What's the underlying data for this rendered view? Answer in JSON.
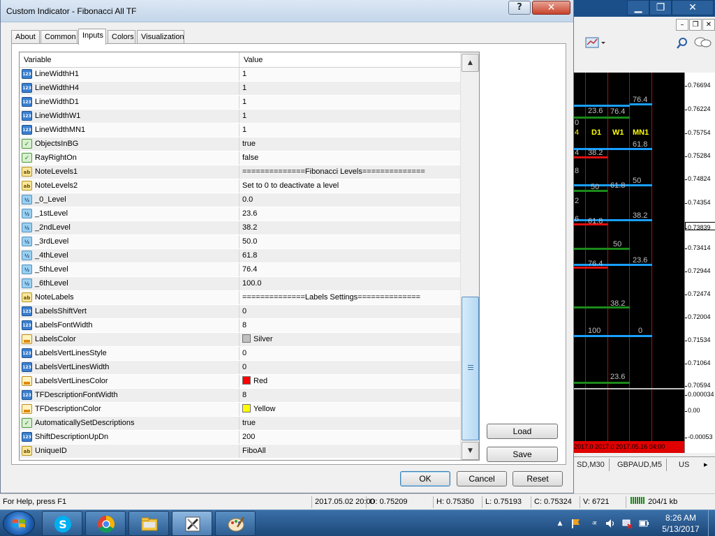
{
  "dialog": {
    "title": "Custom Indicator - Fibonacci All TF",
    "help_glyph": "?",
    "close_glyph": "✕",
    "tabs": [
      "About",
      "Common",
      "Inputs",
      "Colors",
      "Visualization"
    ],
    "active_tab": "Inputs",
    "grid": {
      "col_variable": "Variable",
      "col_value": "Value",
      "rows": [
        {
          "type": "int",
          "name": "LineWidthH1",
          "value": "1"
        },
        {
          "type": "int",
          "name": "LineWidthH4",
          "value": "1"
        },
        {
          "type": "int",
          "name": "LineWidthD1",
          "value": "1"
        },
        {
          "type": "int",
          "name": "LineWidthW1",
          "value": "1"
        },
        {
          "type": "int",
          "name": "LineWidthMN1",
          "value": "1"
        },
        {
          "type": "bool",
          "name": "ObjectsInBG",
          "value": "true"
        },
        {
          "type": "bool",
          "name": "RayRightOn",
          "value": "false"
        },
        {
          "type": "str",
          "name": "NoteLevels1",
          "value": "==============Fibonacci Levels=============="
        },
        {
          "type": "str",
          "name": "NoteLevels2",
          "value": "Set to 0 to deactivate a level"
        },
        {
          "type": "dbl",
          "name": "_0_Level",
          "value": "0.0"
        },
        {
          "type": "dbl",
          "name": "_1stLevel",
          "value": "23.6"
        },
        {
          "type": "dbl",
          "name": "_2ndLevel",
          "value": "38.2"
        },
        {
          "type": "dbl",
          "name": "_3rdLevel",
          "value": "50.0"
        },
        {
          "type": "dbl",
          "name": "_4thLevel",
          "value": "61.8"
        },
        {
          "type": "dbl",
          "name": "_5thLevel",
          "value": "76.4"
        },
        {
          "type": "dbl",
          "name": "_6thLevel",
          "value": "100.0"
        },
        {
          "type": "str",
          "name": "NoteLabels",
          "value": "==============Labels Settings=============="
        },
        {
          "type": "int",
          "name": "LabelsShiftVert",
          "value": "0"
        },
        {
          "type": "int",
          "name": "LabelsFontWidth",
          "value": "8"
        },
        {
          "type": "clr",
          "name": "LabelsColor",
          "value": "Silver",
          "swatch": "#c0c0c0"
        },
        {
          "type": "int",
          "name": "LabelsVertLinesStyle",
          "value": "0"
        },
        {
          "type": "int",
          "name": "LabelsVertLinesWidth",
          "value": "0"
        },
        {
          "type": "clr",
          "name": "LabelsVertLinesColor",
          "value": "Red",
          "swatch": "#ff0000"
        },
        {
          "type": "int",
          "name": "TFDescriptionFontWidth",
          "value": "8"
        },
        {
          "type": "clr",
          "name": "TFDescriptionColor",
          "value": "Yellow",
          "swatch": "#ffff00"
        },
        {
          "type": "bool",
          "name": "AutomaticallySetDescriptions",
          "value": "true"
        },
        {
          "type": "int",
          "name": "ShiftDescriptionUpDn",
          "value": "200"
        },
        {
          "type": "str",
          "name": "UniqueID",
          "value": "FiboAll"
        }
      ]
    },
    "scroll_up_glyph": "▲",
    "scroll_down_glyph": "▼",
    "load_label": "Load",
    "save_label": "Save",
    "ok_label": "OK",
    "cancel_label": "Cancel",
    "reset_label": "Reset"
  },
  "chart": {
    "prices": [
      "0.76694",
      "0.76224",
      "0.75754",
      "0.75284",
      "0.74824",
      "0.74354",
      "0.73839",
      "0.73414",
      "0.72944",
      "0.72474",
      "0.72004",
      "0.71534",
      "0.71064",
      "0.70594",
      "0.000034",
      "0.00",
      "-0.00053"
    ],
    "tf_labels": [
      "D1",
      "W1",
      "MN1"
    ],
    "level_labels": [
      "76.4",
      "23.6",
      "76.4",
      "61.8",
      "38.2",
      "50",
      "61.8",
      "50",
      "38.2",
      "61.8",
      "50",
      "76.4",
      "23.6",
      "38.2",
      "100",
      "0",
      "23.6"
    ],
    "edge_digits": [
      "0",
      "4",
      "4",
      "8",
      "2",
      "6"
    ],
    "time_axis": "2017.0 2017.0 2017.05.16 04:00",
    "tabs": [
      "SD,M30",
      "GBPAUD,M5",
      "US"
    ],
    "tab_arrow_right": "▸",
    "colors": {
      "background": "#000000",
      "vlines": "#b01010",
      "level_blue": "#19a0ff",
      "level_green": "#1a8a1a",
      "level_red": "#e01010",
      "labels": "#c0c0c0",
      "tf_desc": "#ffff00"
    }
  },
  "bg_window": {
    "minimize_glyph": "▁",
    "restore_glyph": "❐",
    "close_glyph": "✕",
    "mdi_buttons": [
      "–",
      "❐",
      "✕"
    ]
  },
  "statusbar": {
    "help": "For Help, press F1",
    "datetime": "2017.05.02 20:00",
    "open": "O: 0.75209",
    "high": "H: 0.75350",
    "low": "L: 0.75193",
    "close": "C: 0.75324",
    "volume": "V: 6721",
    "traffic": "204/1 kb"
  },
  "taskbar": {
    "apps": [
      "skype-icon",
      "chrome-icon",
      "file-explorer-icon",
      "metatrader-icon",
      "paint-icon"
    ],
    "time": "8:26 AM",
    "date": "5/13/2017"
  }
}
